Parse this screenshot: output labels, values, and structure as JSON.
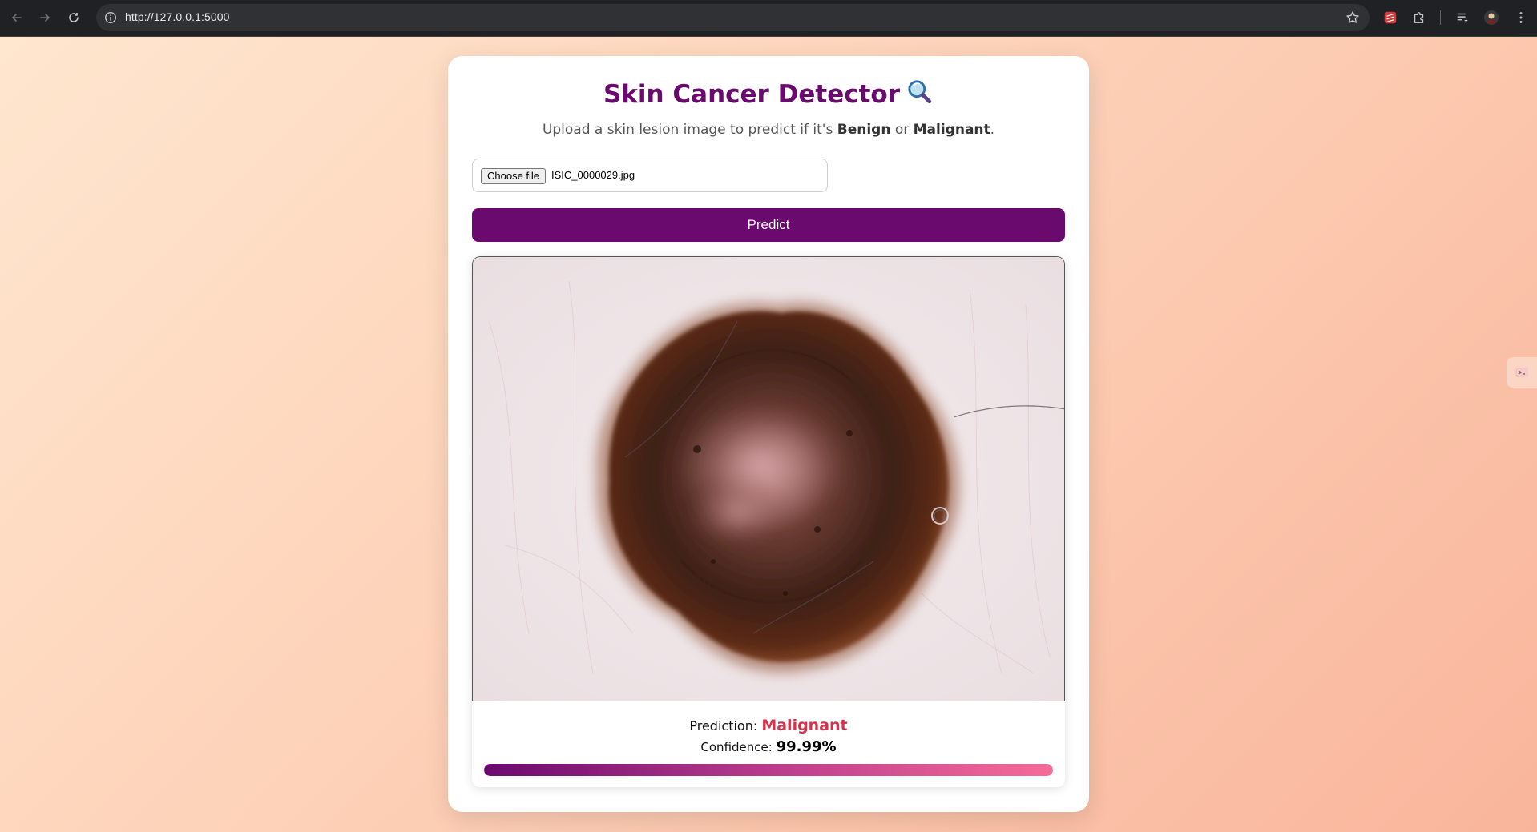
{
  "browser": {
    "url": "http://127.0.0.1:5000"
  },
  "header": {
    "title": "Skin Cancer Detector",
    "title_icon": "magnifying-glass-icon"
  },
  "subtitle": {
    "prefix": "Upload a skin lesion image to predict if it's ",
    "benign": "Benign",
    "middle": " or ",
    "malignant": "Malignant",
    "suffix": "."
  },
  "upload": {
    "button_label": "Choose file",
    "file_name": "ISIC_0000029.jpg"
  },
  "predict_label": "Predict",
  "result": {
    "prediction_label": "Prediction:",
    "prediction_value": "Malignant",
    "confidence_label": "Confidence:",
    "confidence_value": "99.99%",
    "confidence_fraction": 0.9999
  },
  "colors": {
    "accent": "#6a0a6f",
    "malignant": "#d0344c",
    "bar_end": "#f56c98"
  }
}
